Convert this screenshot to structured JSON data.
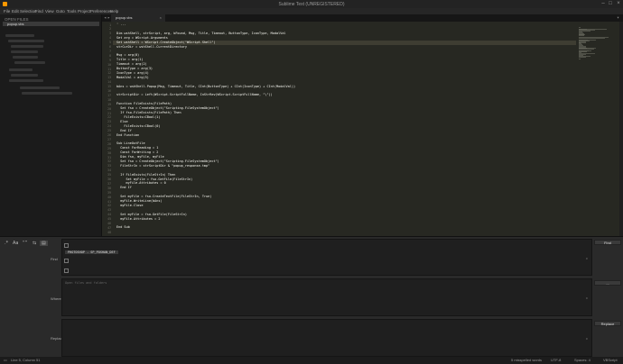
{
  "window": {
    "title": "Sublime Text (UNREGISTERED)"
  },
  "menu": [
    "File",
    "Edit",
    "Selection",
    "Find",
    "View",
    "Goto",
    "Tools",
    "Project",
    "Preferences",
    "Help"
  ],
  "sidebar": {
    "header": "OPEN FILES",
    "open_file": "popup.vbs"
  },
  "tab": {
    "name": "popup.vbs",
    "close": "×"
  },
  "editor": {
    "current_line": 5,
    "lines": [
      {
        "n": "1",
        "t": "' ... "
      },
      {
        "n": "2",
        "t": ""
      },
      {
        "n": "3",
        "t": "Dim wshShell, strScript, arg, bFound, Msg, Title, Timeout, ButtonType, IconType, ModalVal"
      },
      {
        "n": "4",
        "t": "Set arg = WScript.Arguments"
      },
      {
        "n": "5",
        "t": "Set wshShell = WScript.CreateObject(\"WScript.Shell\")"
      },
      {
        "n": "6",
        "t": "strCurDir = wshShell.CurrentDirectory"
      },
      {
        "n": "7",
        "t": ""
      },
      {
        "n": "8",
        "t": "Msg = arg(0)"
      },
      {
        "n": "9",
        "t": "Title = arg(1)"
      },
      {
        "n": "10",
        "t": "Timeout = arg(2)"
      },
      {
        "n": "11",
        "t": "ButtonType = arg(3)"
      },
      {
        "n": "12",
        "t": "IconType = arg(4)"
      },
      {
        "n": "13",
        "t": "ModalVal = arg(5)"
      },
      {
        "n": "14",
        "t": ""
      },
      {
        "n": "15",
        "t": "bAns = wshShell.Popup(Msg, Timeout, Title, CInt(ButtonType) + CInt(IconType) + CInt(ModalVal))"
      },
      {
        "n": "16",
        "t": ""
      },
      {
        "n": "17",
        "t": "strScriptDir = Left(WScript.ScriptFullName, InStrRev(WScript.ScriptFullName, \"\\\"))"
      },
      {
        "n": "18",
        "t": ""
      },
      {
        "n": "19",
        "t": "Function FileExists(FilePath)"
      },
      {
        "n": "20",
        "t": "  Set fso = CreateObject(\"Scripting.FileSystemObject\")"
      },
      {
        "n": "21",
        "t": "  If fso.FileExists(FilePath) Then"
      },
      {
        "n": "22",
        "t": "    FileExists=CBool(1)"
      },
      {
        "n": "23",
        "t": "  Else"
      },
      {
        "n": "24",
        "t": "    FileExists=CBool(0)"
      },
      {
        "n": "25",
        "t": "  End If"
      },
      {
        "n": "26",
        "t": "End Function"
      },
      {
        "n": "27",
        "t": ""
      },
      {
        "n": "28",
        "t": "Sub LineOutFile"
      },
      {
        "n": "29",
        "t": "  Const ForReading = 1"
      },
      {
        "n": "30",
        "t": "  Const ForWriting = 2"
      },
      {
        "n": "31",
        "t": "  Dim fso, myFile, myFile"
      },
      {
        "n": "32",
        "t": "  Set fso = CreateObject(\"Scripting.FileSystemObject\")"
      },
      {
        "n": "33",
        "t": "  FileStrIn = strScriptDir & \"popup_response.tmp\""
      },
      {
        "n": "34",
        "t": ""
      },
      {
        "n": "35",
        "t": "  If FileExists(FileStrIn) Then"
      },
      {
        "n": "36",
        "t": "     Set myFile = fso.GetFile(FileStrIn)"
      },
      {
        "n": "37",
        "t": "     myFile.Attributes = 0"
      },
      {
        "n": "38",
        "t": "  End If"
      },
      {
        "n": "39",
        "t": ""
      },
      {
        "n": "40",
        "t": "  Set myFile = fso.CreateTextFile(FileStrIn, True)"
      },
      {
        "n": "41",
        "t": "  myFile.WriteLine(bAns)"
      },
      {
        "n": "42",
        "t": "  myFile.Close"
      },
      {
        "n": "43",
        "t": ""
      },
      {
        "n": "44",
        "t": "  Set myFile = fso.GetFile(FileStrIn)"
      },
      {
        "n": "45",
        "t": "  myFile.Attributes = 2"
      },
      {
        "n": "46",
        "t": ""
      },
      {
        "n": "47",
        "t": "End Sub"
      },
      {
        "n": "48",
        "t": ""
      }
    ]
  },
  "find_panel": {
    "find_label": "Find",
    "where_label": "Where",
    "replace_label": "Replace",
    "find_value": "PHOTOSHOP - SP_POSHAN_DEF",
    "where_placeholder": "Open files and folders",
    "find_button": "Find",
    "where_button": "...",
    "replace_button": "Replace",
    "toggles": [
      "regex",
      "case",
      "word",
      "wrap",
      "context"
    ]
  },
  "status": {
    "left": "Line 5, Column 51",
    "middle": "5 misspelled words",
    "encoding": "UTF-8",
    "spaces": "Spaces: 4",
    "syntax": "VBScript"
  }
}
